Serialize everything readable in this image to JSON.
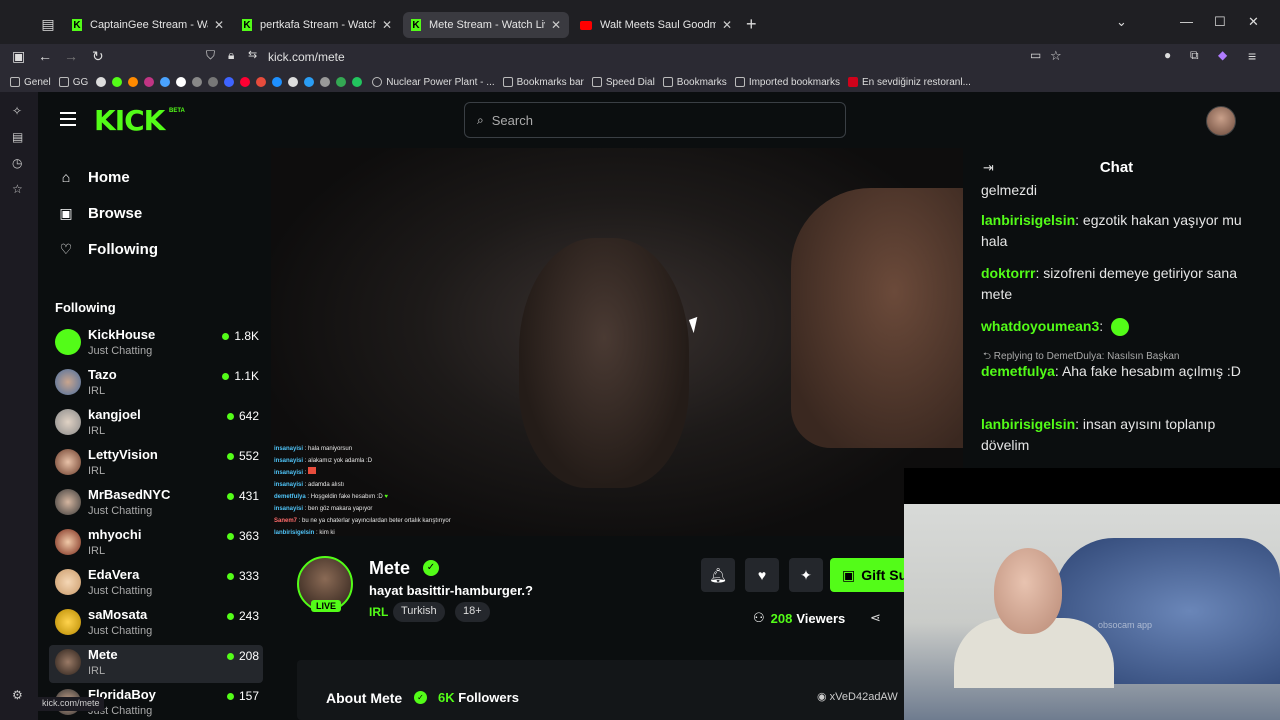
{
  "browser": {
    "tabs": [
      {
        "title": "CaptainGee Stream - Watch Live",
        "icon": "kick-icon"
      },
      {
        "title": "pertkafa Stream - Watch Live o",
        "icon": "kick-icon"
      },
      {
        "title": "Mete Stream - Watch Live on K",
        "icon": "kick-icon",
        "active": true
      },
      {
        "title": "Walt Meets Saul Goodman For",
        "icon": "youtube-icon"
      }
    ],
    "url": "kick.com/mete",
    "status_url": "kick.com/mete",
    "bookmarks": [
      "Genel",
      "GG",
      "Nuclear Power Plant - ...",
      "Bookmarks bar",
      "Speed Dial",
      "Bookmarks",
      "Imported bookmarks",
      "En sevdiğiniz restoranl..."
    ]
  },
  "kick": {
    "logo": "KICK",
    "beta": "BETA",
    "search_placeholder": "Search",
    "nav": [
      {
        "label": "Home",
        "icon": "home-icon"
      },
      {
        "label": "Browse",
        "icon": "browse-icon"
      },
      {
        "label": "Following",
        "icon": "heart-icon"
      }
    ],
    "following_title": "Following",
    "channels": [
      {
        "name": "KickHouse",
        "category": "Just Chatting",
        "viewers": "1.8K"
      },
      {
        "name": "Tazo",
        "category": "IRL",
        "viewers": "1.1K"
      },
      {
        "name": "kangjoel",
        "category": "IRL",
        "viewers": "642"
      },
      {
        "name": "LettyVision",
        "category": "IRL",
        "viewers": "552"
      },
      {
        "name": "MrBasedNYC",
        "category": "Just Chatting",
        "viewers": "431"
      },
      {
        "name": "mhyochi",
        "category": "IRL",
        "viewers": "363"
      },
      {
        "name": "EdaVera",
        "category": "Just Chatting",
        "viewers": "333"
      },
      {
        "name": "saMosata",
        "category": "Just Chatting",
        "viewers": "243"
      },
      {
        "name": "Mete",
        "category": "IRL",
        "viewers": "208",
        "selected": true
      },
      {
        "name": "FloridaBoy",
        "category": "Just Chatting",
        "viewers": "157"
      }
    ]
  },
  "overlay_chat": [
    {
      "user": "insanayisi",
      "text": "hala maniyorsun"
    },
    {
      "user": "insanayisi",
      "text": "alakamız yok adamla :D"
    },
    {
      "user": "insanayisi",
      "text": ""
    },
    {
      "user": "insanayisi",
      "text": "adamda alıstı"
    },
    {
      "user": "demetfulya",
      "text": "Hoşgeldin fake hesabım :D"
    },
    {
      "user": "insanayisi",
      "text": "ben göz makara yapıyor"
    },
    {
      "user": "Sanem7",
      "text": "bu ne ya chaterlar yayıncılardan beter ortalık karıştırıyor"
    },
    {
      "user": "lanbirisigelsin",
      "text": "kim ki"
    }
  ],
  "chat": {
    "title": "Chat",
    "partial_top": "gelmezdi",
    "messages": [
      {
        "user": "lanbirisigelsin",
        "text": "egzotik hakan yaşıyor mu hala"
      },
      {
        "user": "doktorrr",
        "text": "sizofreni demeye getiriyor sana mete"
      },
      {
        "user": "whatdoyoumean3",
        "text": ""
      },
      {
        "user": "demetfulya",
        "text": "Aha fake hesabım açılmış :D",
        "reply": "Replying to DemetDulya: Nasılsın Başkan"
      },
      {
        "user": "lanbirisigelsin",
        "text": "insan ayısını toplanıp dövelim"
      }
    ]
  },
  "stream": {
    "name": "Mete",
    "title": "hayat basittir-hamburger.?",
    "category": "IRL",
    "tags": [
      "Turkish",
      "18+"
    ],
    "live": "LIVE",
    "gift_label": "Gift Su",
    "viewers_count": "208",
    "viewers_label": "Viewers",
    "about_title": "About Mete",
    "followers_count": "6K",
    "followers_label": "Followers",
    "discord": "xVeD42adAW"
  },
  "webcam": {
    "watermark": "obsocam app"
  },
  "colors": {
    "accent": "#53fc18",
    "bg": "#0b0e0f"
  }
}
